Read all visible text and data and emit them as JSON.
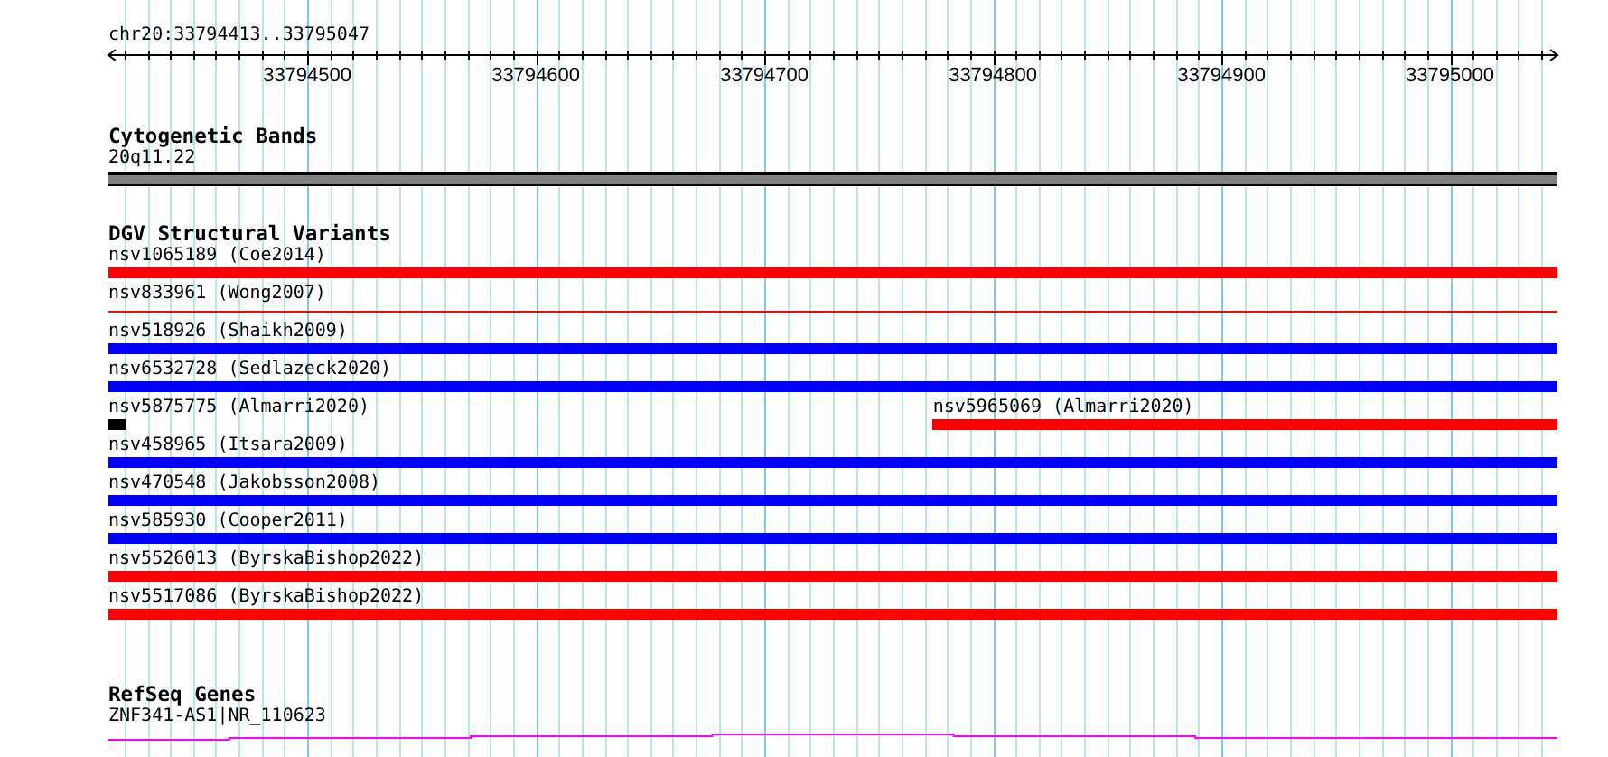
{
  "location": "chr20:33794413..33795047",
  "axis": {
    "ticks": [
      "33794500",
      "33794600",
      "33794700",
      "33794800",
      "33794900",
      "33795000"
    ]
  },
  "tracks": [
    {
      "kind": "bands",
      "title": "Cytogenetic Bands",
      "label": "20q11.22"
    },
    {
      "kind": "variants",
      "title": "DGV Structural Variants",
      "rows": [
        {
          "features": [
            {
              "label": "nsv1065189 (Coe2014)",
              "kind": "full",
              "color": "#ff0000"
            }
          ]
        },
        {
          "features": [
            {
              "label": "nsv833961 (Wong2007)",
              "kind": "thin",
              "color": "#ff0000"
            }
          ]
        },
        {
          "features": [
            {
              "label": "nsv518926 (Shaikh2009)",
              "kind": "full",
              "color": "#0000ff"
            }
          ]
        },
        {
          "features": [
            {
              "label": "nsv6532728 (Sedlazeck2020)",
              "kind": "full",
              "color": "#0000ff"
            }
          ]
        },
        {
          "features": [
            {
              "label": "nsv5875775 (Almarri2020)",
              "kind": "stub",
              "color": "#000000"
            },
            {
              "label": "nsv5965069 (Almarri2020)",
              "kind": "tail",
              "color": "#ff0000"
            }
          ]
        },
        {
          "features": [
            {
              "label": "nsv458965 (Itsara2009)",
              "kind": "full",
              "color": "#0000ff"
            }
          ]
        },
        {
          "features": [
            {
              "label": "nsv470548 (Jakobsson2008)",
              "kind": "full",
              "color": "#0000ff"
            }
          ]
        },
        {
          "features": [
            {
              "label": "nsv585930 (Cooper2011)",
              "kind": "full",
              "color": "#0000ff"
            }
          ]
        },
        {
          "features": [
            {
              "label": "nsv5526013 (ByrskaBishop2022)",
              "kind": "full",
              "color": "#ff0000"
            }
          ]
        },
        {
          "features": [
            {
              "label": "nsv5517086 (ByrskaBishop2022)",
              "kind": "full",
              "color": "#ff0000"
            }
          ]
        }
      ]
    },
    {
      "kind": "genes",
      "title": "RefSeq Genes",
      "label": "ZNF341-AS1|NR_110623"
    }
  ]
}
